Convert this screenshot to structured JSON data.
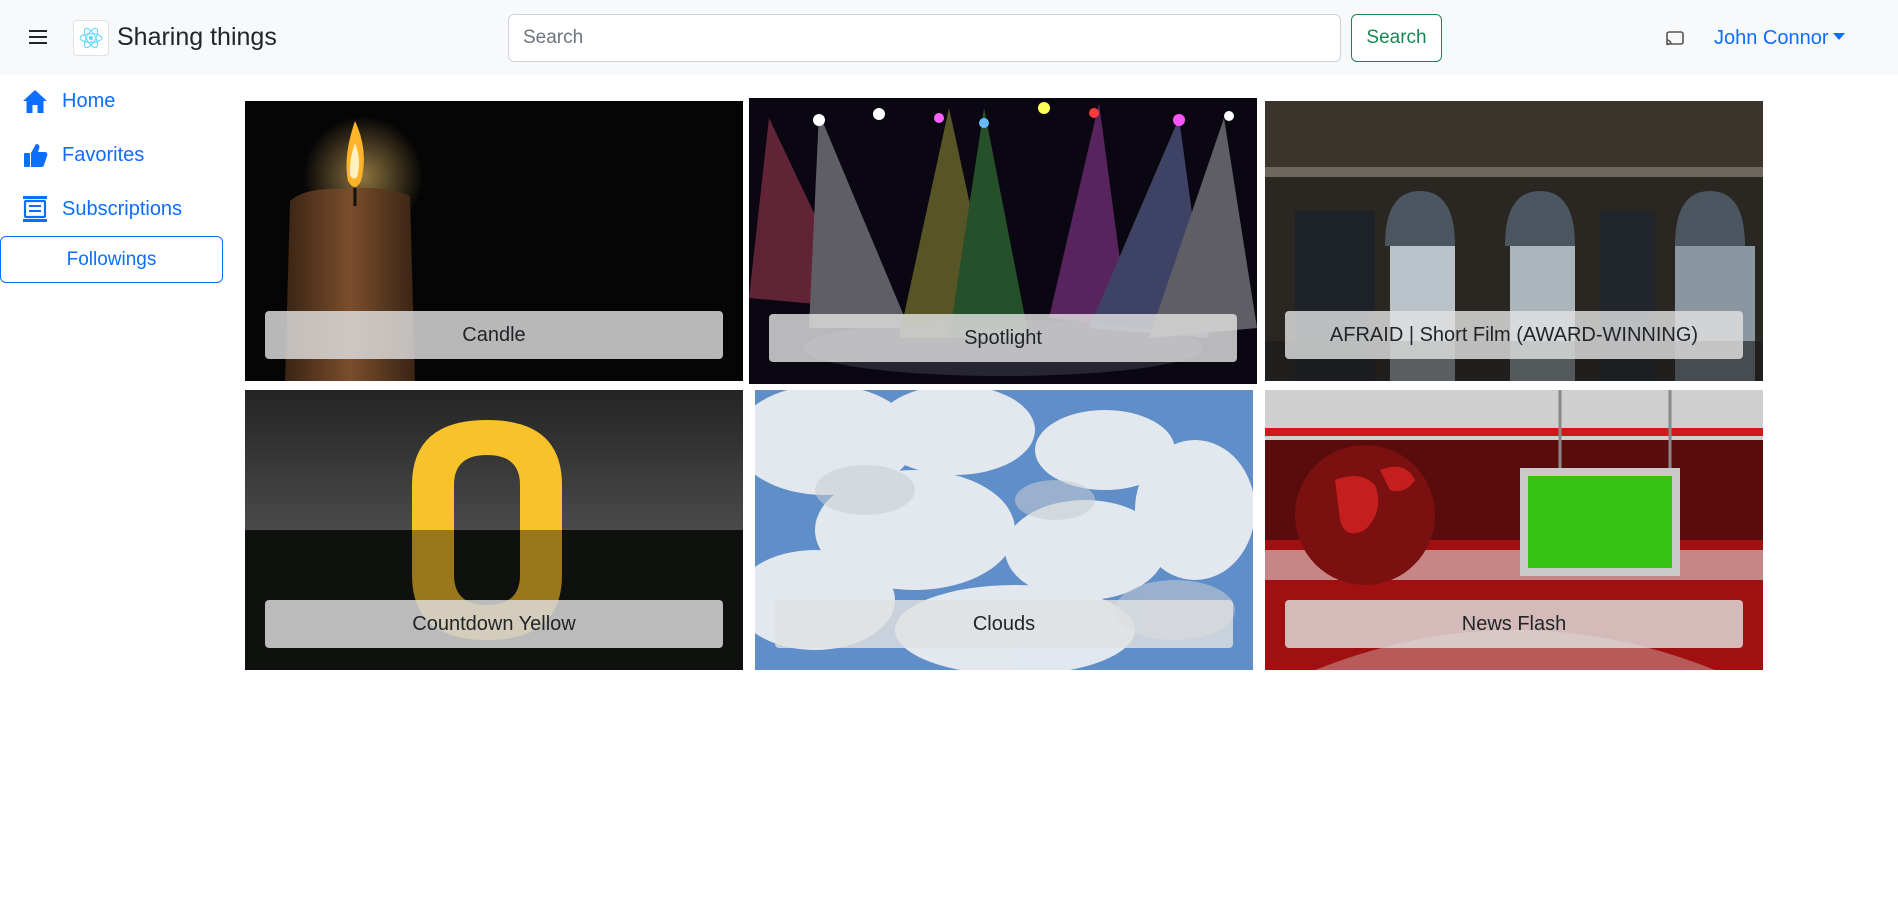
{
  "header": {
    "brand_title": "Sharing things",
    "menu_icon": "hamburger-menu-icon",
    "logo_icon": "react-logo-icon",
    "notification_icon": "cast-icon"
  },
  "search": {
    "placeholder": "Search",
    "value": "",
    "button_label": "Search"
  },
  "user_menu": {
    "name": "John Connor"
  },
  "sidebar": {
    "items": [
      {
        "label": "Home",
        "icon": "house-icon"
      },
      {
        "label": "Favorites",
        "icon": "thumbs-up-icon"
      },
      {
        "label": "Subscriptions",
        "icon": "subscriptions-icon"
      }
    ],
    "followings_label": "Followings"
  },
  "videos": [
    {
      "title": "Candle"
    },
    {
      "title": "Spotlight"
    },
    {
      "title": "AFRAID | Short Film (AWARD-WINNING)"
    },
    {
      "title": "Countdown Yellow"
    },
    {
      "title": "Clouds"
    },
    {
      "title": "News Flash"
    }
  ],
  "colors": {
    "primary": "#0d6efd",
    "success": "#198754",
    "navbar_bg": "#f8f9fa"
  }
}
